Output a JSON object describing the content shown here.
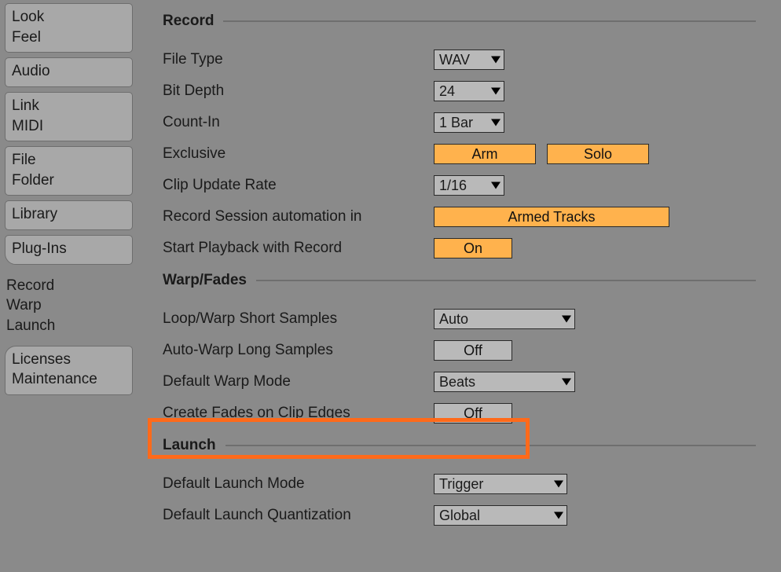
{
  "sidebar": {
    "lookfeel": [
      "Look",
      "Feel"
    ],
    "audio": "Audio",
    "linkmidi": [
      "Link",
      "MIDI"
    ],
    "filefolder": [
      "File",
      "Folder"
    ],
    "library": "Library",
    "plugins": "Plug-Ins",
    "recordwarp": [
      "Record",
      "Warp",
      "Launch"
    ],
    "licenses": [
      "Licenses",
      "Maintenance"
    ]
  },
  "sections": {
    "record": "Record",
    "warp": "Warp/Fades",
    "launch": "Launch"
  },
  "record": {
    "file_type": {
      "label": "File Type",
      "value": "WAV"
    },
    "bit_depth": {
      "label": "Bit Depth",
      "value": "24"
    },
    "count_in": {
      "label": "Count-In",
      "value": "1 Bar"
    },
    "exclusive": {
      "label": "Exclusive",
      "arm": "Arm",
      "solo": "Solo"
    },
    "clip_update": {
      "label": "Clip Update Rate",
      "value": "1/16"
    },
    "session_auto": {
      "label": "Record Session automation in",
      "value": "Armed Tracks"
    },
    "start_playback": {
      "label": "Start Playback with Record",
      "value": "On"
    }
  },
  "warp": {
    "loop_short": {
      "label": "Loop/Warp Short Samples",
      "value": "Auto"
    },
    "auto_warp_long": {
      "label": "Auto-Warp Long Samples",
      "value": "Off"
    },
    "default_mode": {
      "label": "Default Warp Mode",
      "value": "Beats"
    },
    "create_fades": {
      "label": "Create Fades on Clip Edges",
      "value": "Off"
    }
  },
  "launch": {
    "default_mode": {
      "label": "Default Launch Mode",
      "value": "Trigger"
    },
    "default_quant": {
      "label": "Default Launch Quantization",
      "value": "Global"
    }
  }
}
